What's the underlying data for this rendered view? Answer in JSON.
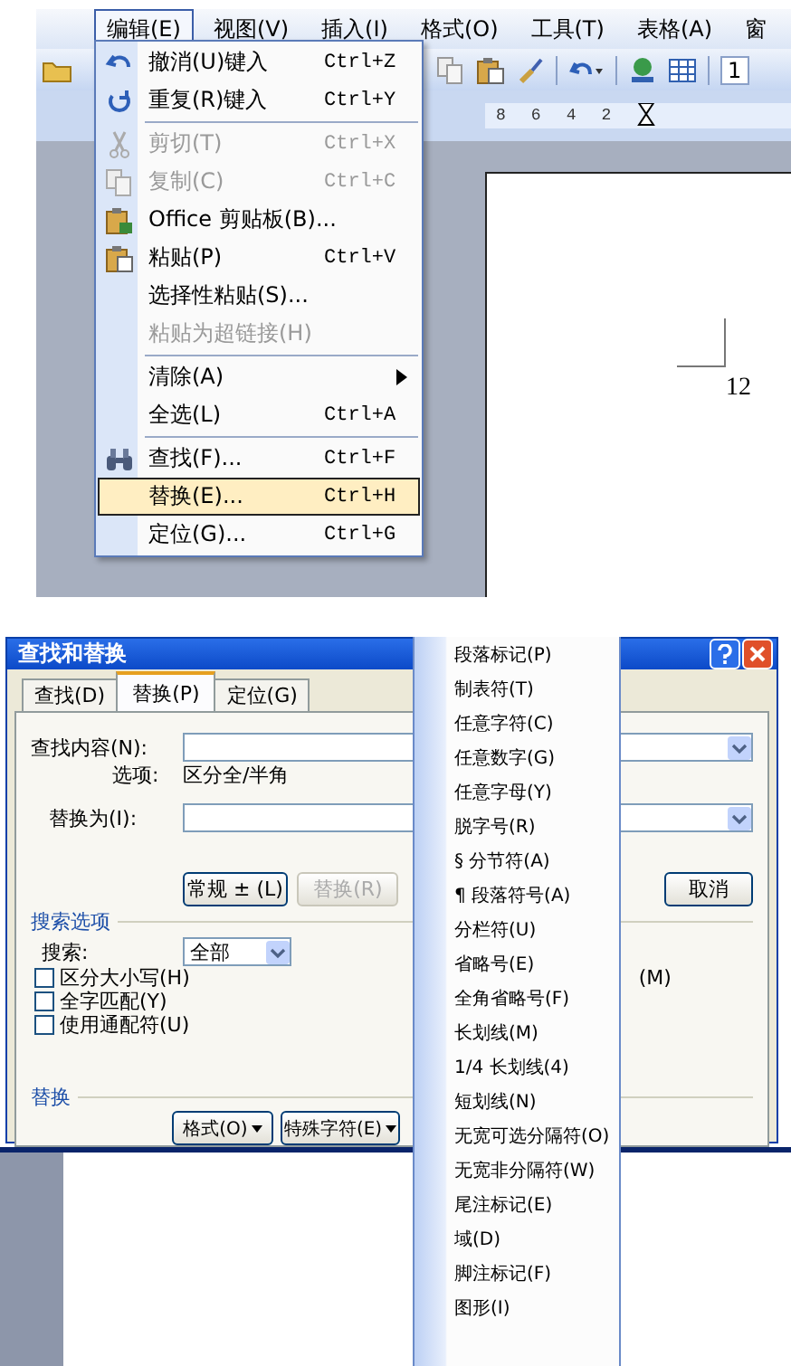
{
  "editor": {
    "menu_bar": [
      {
        "label": "编辑(E)",
        "selected": true
      },
      {
        "label": "视图(V)",
        "selected": false
      },
      {
        "label": "插入(I)",
        "selected": false
      },
      {
        "label": "格式(O)",
        "selected": false
      },
      {
        "label": "工具(T)",
        "selected": false
      },
      {
        "label": "表格(A)",
        "selected": false
      },
      {
        "label": "窗",
        "selected": false
      }
    ],
    "toolbar_text": "1",
    "ruler_labels": [
      "8",
      "6",
      "4",
      "2"
    ],
    "page_text": "12"
  },
  "edit_menu": {
    "items": [
      {
        "kind": "item",
        "label": "撤消(U)键入",
        "shortcut": "Ctrl+Z",
        "disabled": false,
        "selected": false
      },
      {
        "kind": "item",
        "label": "重复(R)键入",
        "shortcut": "Ctrl+Y",
        "disabled": false,
        "selected": false
      },
      {
        "kind": "separator"
      },
      {
        "kind": "item",
        "label": "剪切(T)",
        "shortcut": "Ctrl+X",
        "disabled": true,
        "selected": false
      },
      {
        "kind": "item",
        "label": "复制(C)",
        "shortcut": "Ctrl+C",
        "disabled": true,
        "selected": false
      },
      {
        "kind": "item",
        "label": "Office 剪贴板(B)...",
        "disabled": false,
        "selected": false
      },
      {
        "kind": "item",
        "label": "粘贴(P)",
        "shortcut": "Ctrl+V",
        "disabled": false,
        "selected": false
      },
      {
        "kind": "item",
        "label": "选择性粘贴(S)...",
        "disabled": false,
        "selected": false
      },
      {
        "kind": "item",
        "label": "粘贴为超链接(H)",
        "disabled": true,
        "selected": false
      },
      {
        "kind": "separator"
      },
      {
        "kind": "submenu",
        "label": "清除(A)",
        "disabled": false,
        "selected": false
      },
      {
        "kind": "item",
        "label": "全选(L)",
        "shortcut": "Ctrl+A",
        "disabled": false,
        "selected": false
      },
      {
        "kind": "separator"
      },
      {
        "kind": "item",
        "label": "查找(F)...",
        "shortcut": "Ctrl+F",
        "disabled": false,
        "selected": false
      },
      {
        "kind": "item",
        "label": "替换(E)...",
        "shortcut": "Ctrl+H",
        "disabled": false,
        "selected": true
      },
      {
        "kind": "item",
        "label": "定位(G)...",
        "shortcut": "Ctrl+G",
        "disabled": false,
        "selected": false
      }
    ]
  },
  "dialog": {
    "title": "查找和替换",
    "tabs": [
      {
        "label": "查找(D)",
        "selected": false
      },
      {
        "label": "替换(P)",
        "selected": true
      },
      {
        "label": "定位(G)",
        "selected": false
      }
    ],
    "find_label": "查找内容(N):",
    "options_label": "选项:",
    "options_value": "区分全/半角",
    "replace_label": "替换为(I):",
    "buttons": [
      {
        "label": "常规 ± (L)",
        "disabled": false
      },
      {
        "label": "替换(R)",
        "disabled": true
      },
      {
        "label": "取消",
        "disabled": false
      }
    ],
    "search_section": "搜索选项",
    "search_label": "搜索:",
    "search_value": "全部",
    "checkboxes": [
      {
        "label": "区分大小写(H)",
        "checked": false
      },
      {
        "label": "全字匹配(Y)",
        "checked": false
      },
      {
        "label": "使用通配符(U)",
        "checked": false
      }
    ],
    "hidden_button_text": "(M)",
    "replace_section": "替换",
    "bottom_buttons": [
      "格式(O)",
      "特殊字符(E)"
    ]
  },
  "special_menu": {
    "items": [
      "段落标记(P)",
      "制表符(T)",
      "任意字符(C)",
      "任意数字(G)",
      "任意字母(Y)",
      "脱字号(R)",
      "§ 分节符(A)",
      "¶ 段落符号(A)",
      "分栏符(U)",
      "省略号(E)",
      "全角省略号(F)",
      "长划线(M)",
      "1/4 长划线(4)",
      "短划线(N)",
      "无宽可选分隔符(O)",
      "无宽非分隔符(W)",
      "尾注标记(E)",
      "域(D)",
      "脚注标记(F)",
      "图形(I)"
    ]
  }
}
